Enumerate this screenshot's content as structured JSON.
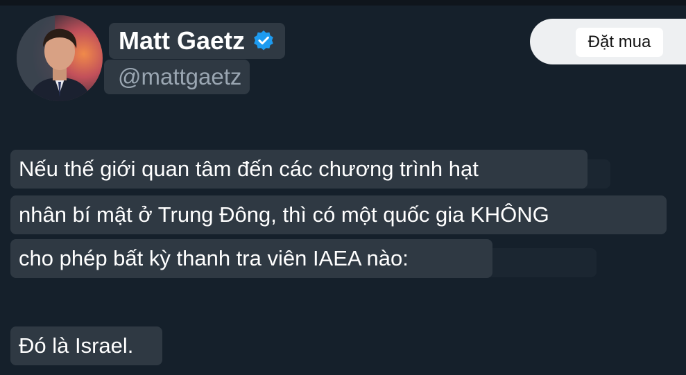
{
  "profile": {
    "display_name": "Matt Gaetz",
    "handle": "@mattgaetz",
    "verified_icon": "verified-badge-icon",
    "verified_color": "#1d9bf0"
  },
  "subscribe": {
    "label": "Đặt mua"
  },
  "tweet": {
    "lines": [
      "Nếu thế giới quan tâm đến các chương trình hạt",
      "nhân bí mật ở Trung Đông, thì có một quốc gia KHÔNG",
      "cho phép bất kỳ thanh tra viên IAEA nào:",
      "Đó là Israel."
    ]
  },
  "colors": {
    "background": "#15202b",
    "highlight": "#2f3943",
    "text": "#ffffff",
    "handle_text": "#9aa6b2"
  }
}
